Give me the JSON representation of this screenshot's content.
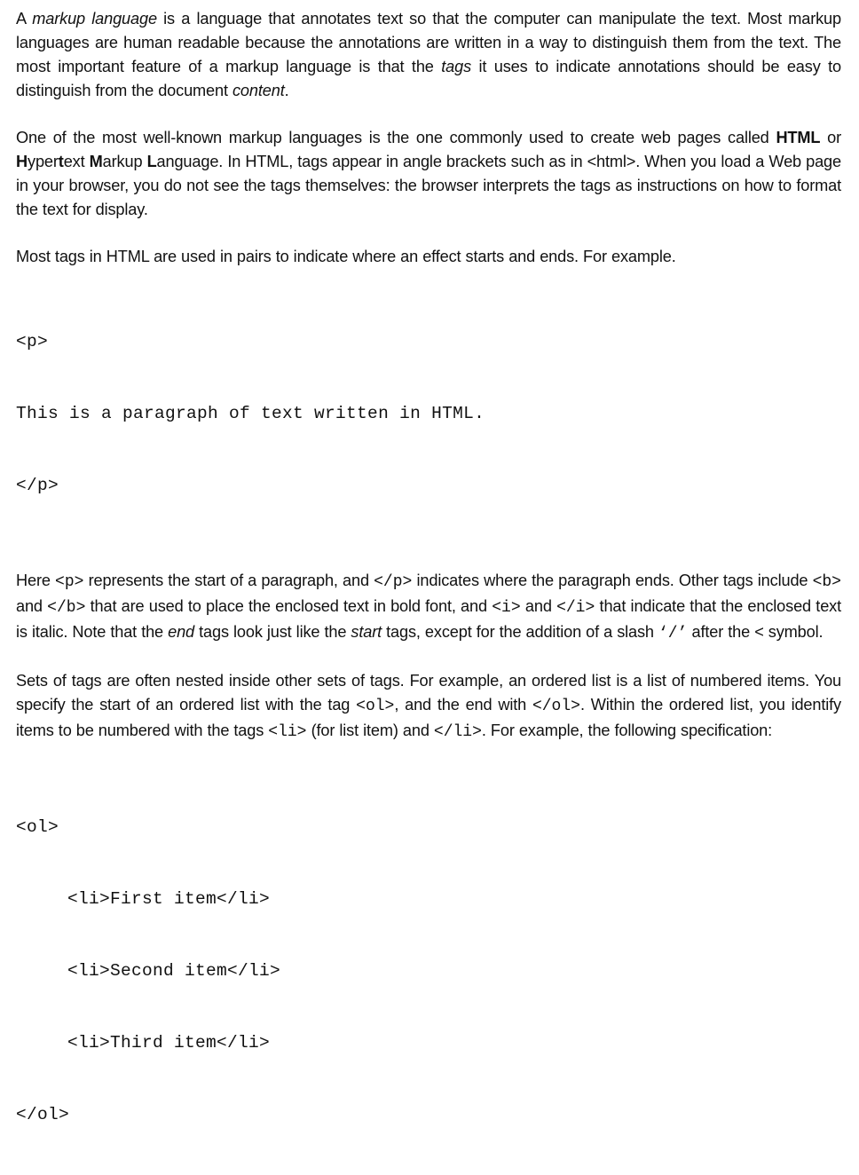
{
  "document": {
    "p1": {
      "s1": "A ",
      "i1": "markup language",
      "s2": " is a language that annotates text so that the computer can manipulate the text. Most markup languages are human readable because the annotations are written in a way to distinguish them from the text. The most important feature of a markup language is that the ",
      "i2": "tags",
      "s3": " it uses to indicate annotations should be easy to distinguish from the document ",
      "i3": "content",
      "s4": "."
    },
    "p2": {
      "s1": "One of the most well-known markup languages is the one commonly used to create web pages called ",
      "b1": "HTML",
      "s2": " or ",
      "b2": "H",
      "s3": "yper",
      "b3": "t",
      "s4": "ext ",
      "b4": "M",
      "s5": "arkup ",
      "b5": "L",
      "s6": "anguage. In HTML, tags appear in angle brackets such as in <html>. When you load a Web page in your browser, you do not see the tags themselves: the browser interprets the tags as instructions on how to format the text for display."
    },
    "p3": "Most tags in HTML are used in pairs to indicate where an effect starts and ends. For example.",
    "code1": [
      "<p>",
      "This is a paragraph of text written in HTML.",
      "</p>"
    ],
    "p4": {
      "s1": "Here ",
      "c1": "<p>",
      "s2": " represents the start of a paragraph, and ",
      "c2": "</p>",
      "s3": " indicates where the paragraph ends. Other tags include ",
      "c3": "<b>",
      "s4": " and ",
      "c4": "</b>",
      "s5": " that are used to place the enclosed text in bold font, and ",
      "c5": "<i>",
      "s6": " and ",
      "c6": "</i>",
      "s7": " that indicate that the enclosed text is italic. Note that the ",
      "i1": "end",
      "s8": " tags look just like the ",
      "i2": "start",
      "s9": " tags, except for the addition of a slash ",
      "c7": "‘/’",
      "s10": " after the < symbol."
    },
    "p5": {
      "s1": "Sets of tags are often nested inside other sets of tags. For example, an ordered list is a list of numbered items. You specify the start of an ordered list with the tag ",
      "c1": "<ol>",
      "s2": ", and the end with ",
      "c2": "</ol>",
      "s3": ". Within the ordered list, you identify items to be numbered with the tags ",
      "c3": "<li>",
      "s4": " (for list item) and ",
      "c4": "</li>",
      "s5": ". For example, the following specification:"
    },
    "code2": {
      "open": "<ol>",
      "items": [
        "<li>First item</li>",
        "<li>Second item</li>",
        "<li>Third item</li>"
      ],
      "close": "</ol>"
    }
  }
}
